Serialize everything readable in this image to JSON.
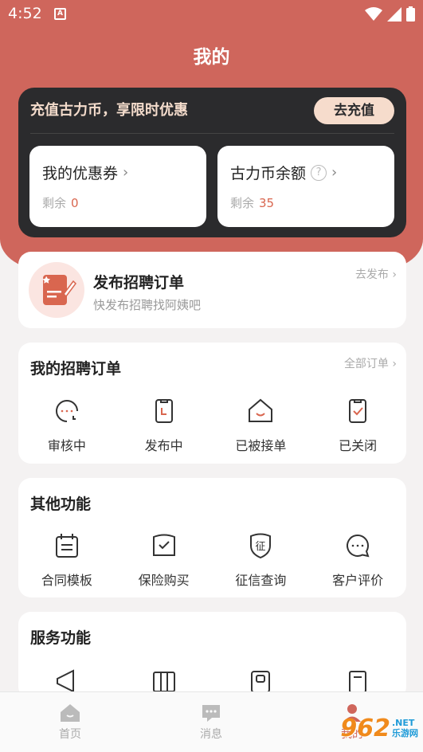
{
  "status_bar": {
    "time": "4:52",
    "badge": "A"
  },
  "header": {
    "title": "我的"
  },
  "promo": {
    "text": "充值古力币，享限时优惠",
    "button": "去充值",
    "coupons": {
      "title": "我的优惠券",
      "sub_label": "剩余",
      "count": "0"
    },
    "coins": {
      "title": "古力币余额",
      "sub_label": "剩余",
      "count": "35"
    }
  },
  "post_order": {
    "title": "发布招聘订单",
    "subtitle": "快发布招聘找阿姨吧",
    "link": "去发布"
  },
  "orders": {
    "title": "我的招聘订单",
    "link": "全部订单",
    "items": [
      {
        "label": "审核中",
        "icon": "clock-chat-icon"
      },
      {
        "label": "发布中",
        "icon": "clipboard-icon"
      },
      {
        "label": "已被接单",
        "icon": "house-icon"
      },
      {
        "label": "已关闭",
        "icon": "clipboard-check-icon"
      }
    ]
  },
  "other": {
    "title": "其他功能",
    "items": [
      {
        "label": "合同模板",
        "icon": "calendar-doc-icon"
      },
      {
        "label": "保险购买",
        "icon": "shield-check-icon"
      },
      {
        "label": "征信查询",
        "icon": "credit-badge-icon",
        "glyph": "征"
      },
      {
        "label": "客户评价",
        "icon": "chat-bubble-icon"
      }
    ]
  },
  "services": {
    "title": "服务功能"
  },
  "tabbar": {
    "tabs": [
      {
        "label": "首页",
        "icon": "home-icon"
      },
      {
        "label": "消息",
        "icon": "message-icon"
      },
      {
        "label": "我的",
        "icon": "profile-icon"
      }
    ]
  },
  "watermark": {
    "num": "962",
    "site": ".NET",
    "cn": "乐游网"
  },
  "colors": {
    "accent": "#cf665c",
    "dark_card": "#2b2b2d",
    "highlight": "#d9664f",
    "button_bg": "#f6dccc"
  }
}
